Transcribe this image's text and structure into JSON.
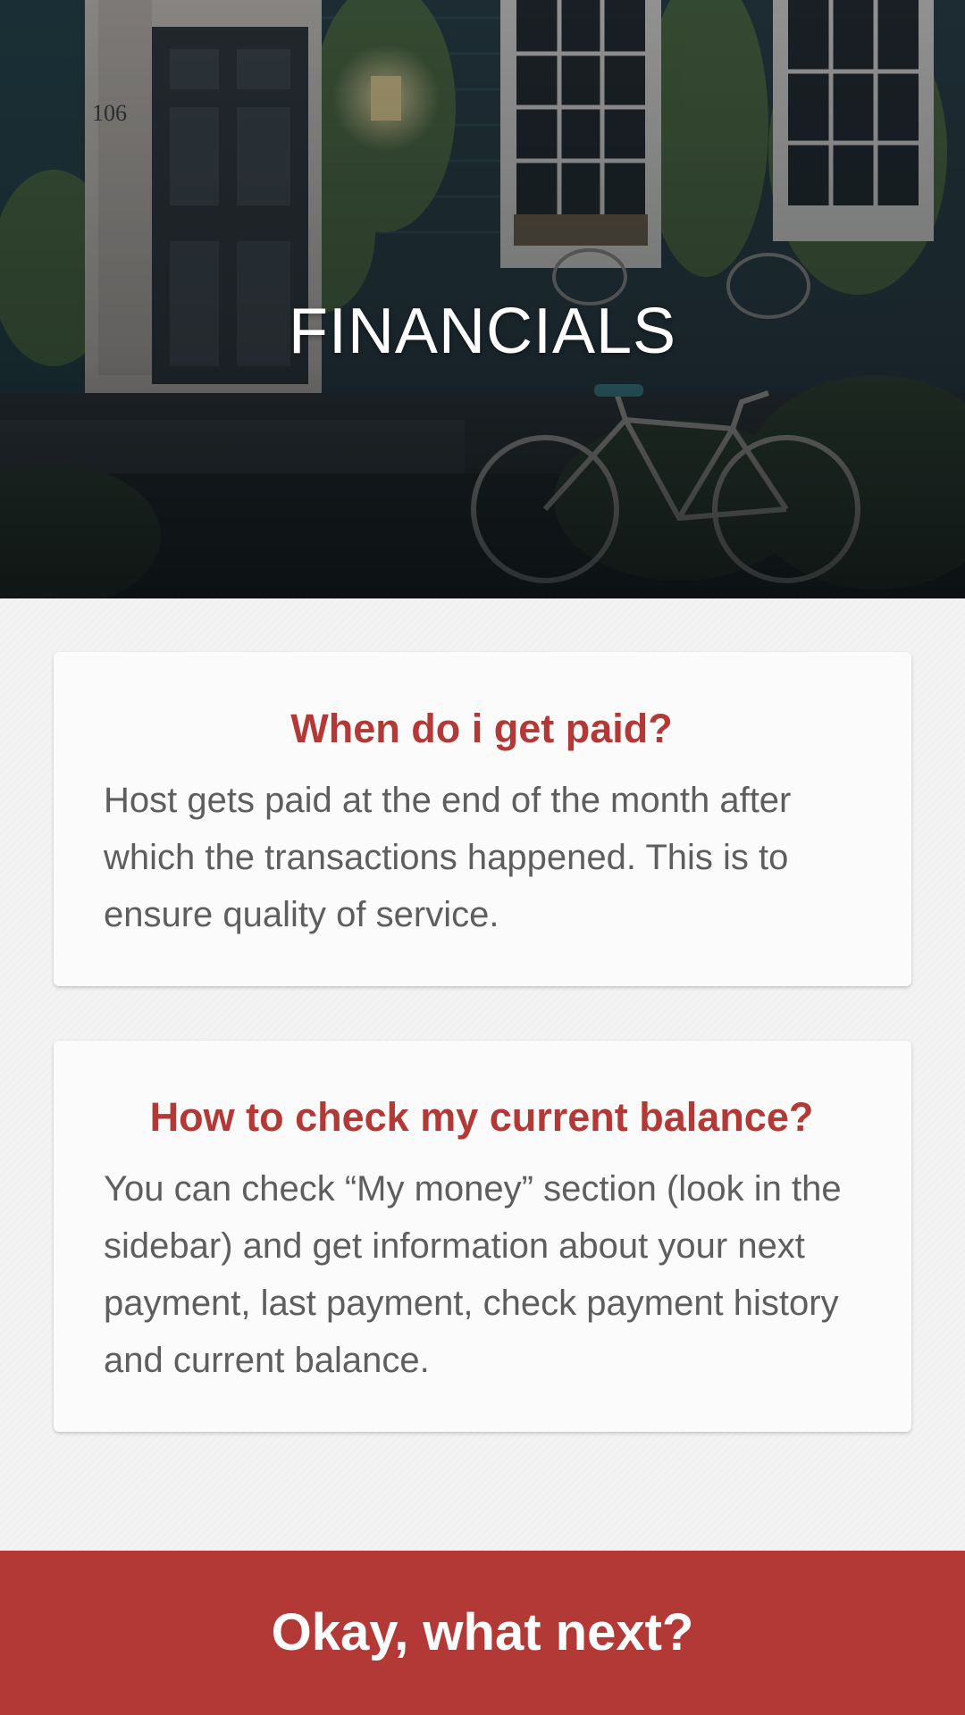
{
  "hero": {
    "title": "FINANCIALS",
    "house_number": "106"
  },
  "faq": [
    {
      "question": "When do i get paid?",
      "answer": "Host gets paid at the end of the month after which the transactions happened. This is to ensure quality of service."
    },
    {
      "question": "How to check my current balance?",
      "answer": "You can check “My money” section (look in the sidebar) and get information about your next payment, last payment, check payment history and current balance."
    }
  ],
  "footer": {
    "next_label": "Okay, what next?"
  },
  "colors": {
    "accent": "#b33936",
    "body_text": "#5e5e5e",
    "background": "#f3f3f3",
    "card": "#fbfbfb"
  }
}
